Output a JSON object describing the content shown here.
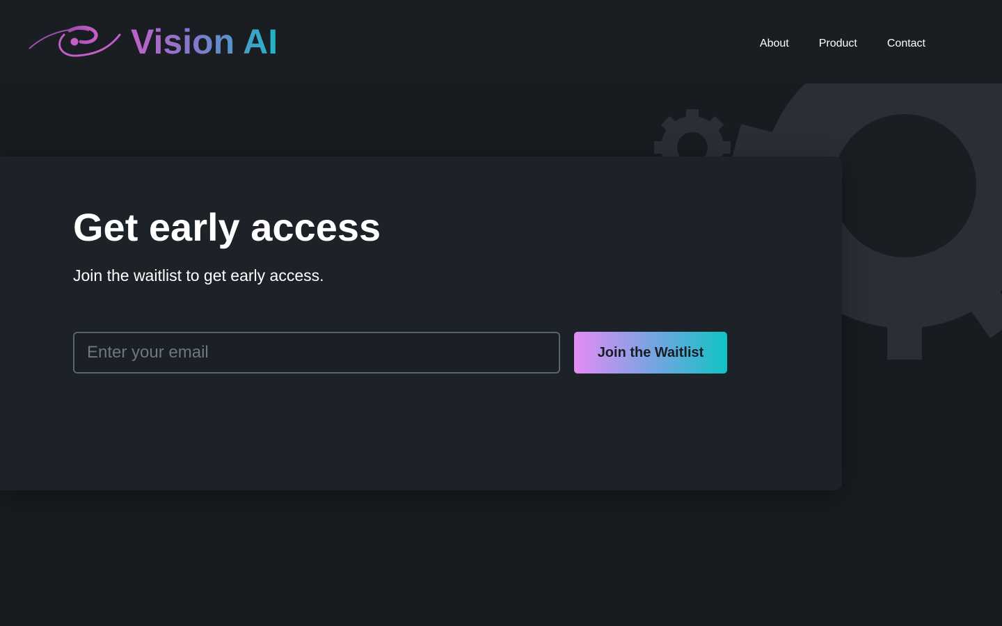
{
  "brand": {
    "name": "Vision AI",
    "logo_icon": "eye-swoosh-icon",
    "gradient_colors": [
      "#c35fc6",
      "#1fb6c4"
    ]
  },
  "nav": {
    "items": [
      {
        "label": "About"
      },
      {
        "label": "Product"
      },
      {
        "label": "Contact"
      }
    ]
  },
  "hero": {
    "title": "Get early access",
    "subtitle": "Join the waitlist to get early access.",
    "email_placeholder": "Enter your email",
    "email_value": "",
    "cta_label": "Join the Waitlist",
    "cta_gradient": [
      "#e48cf5",
      "#10c4c4"
    ]
  },
  "decor": {
    "background_icon": "gear-icon",
    "colors": {
      "page_bg": "#181b20",
      "card_bg": "#1d2128",
      "gear": "#2a2f37"
    }
  }
}
